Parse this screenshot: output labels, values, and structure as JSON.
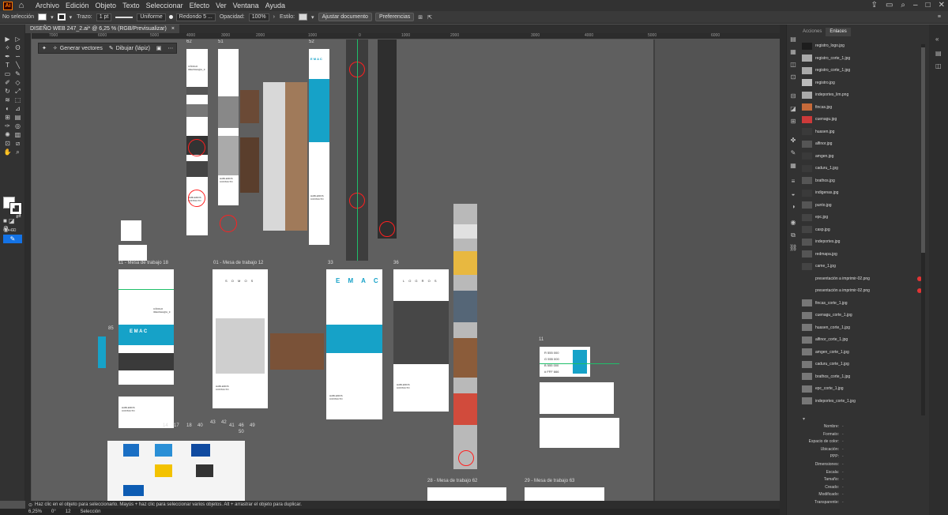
{
  "app": {
    "icon_label": "Ai"
  },
  "menu": [
    "Archivo",
    "Edición",
    "Objeto",
    "Texto",
    "Seleccionar",
    "Efecto",
    "Ver",
    "Ventana",
    "Ayuda"
  ],
  "control": {
    "selection": "No selección",
    "stroke_label": "Trazo:",
    "stroke_weight": "1 pt",
    "profile": "Uniforme",
    "brush": "Redondo 5 ...",
    "opacity_label": "Opacidad:",
    "opacity": "100%",
    "style_label": "Estilo:",
    "fit_doc_button": "Ajustar documento",
    "prefs_button": "Preferencias"
  },
  "document": {
    "tab_title": "DISEÑO WEB 247_2.ai* @ 6,25 % (RGB/Previsualizar)",
    "close": "×"
  },
  "ruler_h_labels": [
    "7000",
    "6000",
    "5000",
    "4000",
    "3000",
    "2000",
    "1000",
    "0",
    "1000",
    "2000",
    "3000",
    "4000",
    "5000",
    "6000"
  ],
  "context_bar": {
    "generate_vectors": "Generar vectores",
    "draw_pencil": "Dibujar (lápiz)"
  },
  "artboards": {
    "labels": [
      "62",
      "51",
      "52",
      "11 - Mesa de trabajo 18",
      "01 - Mesa de trabajo 12",
      "33",
      "36",
      "85",
      "11",
      "28 - Mesa de trabajo 62",
      "29 - Mesa de trabajo 63"
    ],
    "small_labels": [
      "14",
      "17",
      "18",
      "40",
      "43",
      "42",
      "41",
      "46",
      "49",
      "50"
    ]
  },
  "board_text": {
    "somos": "S O M O S",
    "emac": "E M A C",
    "logros": "L O G R O S",
    "hablemos": "HABLEMOS CONTACTO",
    "codigo": "CÓDIGO IDEAS&A@A_9"
  },
  "status": {
    "hint": "Haz clic en el objeto para seleccionarlo. Mayús + haz clic para seleccionar varios objetos. Alt + arrastrar el objeto para duplicar.",
    "zoom": "6,25%",
    "angle": "0°",
    "artboard_num": "12",
    "mode": "Selección"
  },
  "panels": {
    "tab_actions": "Acciones",
    "tab_links": "Enlaces",
    "links": [
      {
        "name": "registro_logo.jpg",
        "warn": false
      },
      {
        "name": "registro_corte_1.jpg",
        "warn": false
      },
      {
        "name": "registro_corte_1.jpg",
        "warn": false
      },
      {
        "name": "registro.jpg",
        "warn": false
      },
      {
        "name": "indeportes_lim.png",
        "warn": false
      },
      {
        "name": "fincas.jpg",
        "warn": false
      },
      {
        "name": "cuenagu.jpg",
        "warn": false
      },
      {
        "name": "huasen.jpg",
        "warn": false
      },
      {
        "name": "alfinor.jpg",
        "warn": false
      },
      {
        "name": "amgen.jpg",
        "warn": false
      },
      {
        "name": "caduru_1.jpg",
        "warn": false
      },
      {
        "name": "brathos.jpg",
        "warn": false
      },
      {
        "name": "indigenas.jpg",
        "warn": false
      },
      {
        "name": "punto.jpg",
        "warn": false
      },
      {
        "name": "epc.jpg",
        "warn": false
      },
      {
        "name": "casp.jpg",
        "warn": false
      },
      {
        "name": "indeportes.jpg",
        "warn": false
      },
      {
        "name": "redmapa.jpg",
        "warn": false
      },
      {
        "name": "came_1.jpg",
        "warn": false
      },
      {
        "name": "presentación a imprimir-02.png",
        "warn": true
      },
      {
        "name": "presentación a imprimir-02.png",
        "warn": true
      },
      {
        "name": "fincas_corte_1.jpg",
        "warn": false
      },
      {
        "name": "cuenagu_corte_1.jpg",
        "warn": false
      },
      {
        "name": "huasen_corte_1.jpg",
        "warn": false
      },
      {
        "name": "alfinor_corte_1.jpg",
        "warn": false
      },
      {
        "name": "amgen_corte_1.jpg",
        "warn": false
      },
      {
        "name": "caduru_corte_1.jpg",
        "warn": false
      },
      {
        "name": "brathos_corte_1.jpg",
        "warn": false
      },
      {
        "name": "epc_corte_1.jpg",
        "warn": false
      },
      {
        "name": "indeportes_corte_1.jpg",
        "warn": false
      }
    ],
    "info_labels": [
      "Nombre:",
      "Formato:",
      "Espacio de color:",
      "Ubicación:",
      "PPP:",
      "Dimensiones:",
      "Escala:",
      "Tamaño:",
      "Creado:",
      "Modificado:",
      "Transparente:"
    ],
    "info_value": "-"
  },
  "swatch_rows": [
    "R 555 000",
    "G 555 000",
    "B 555 000",
    "# FFF 666"
  ],
  "colors": {
    "accent_cyan": "#16a2c8",
    "guide_green": "#1fbf6a",
    "selection_blue": "#1473e6",
    "warn_red": "#e23434"
  }
}
